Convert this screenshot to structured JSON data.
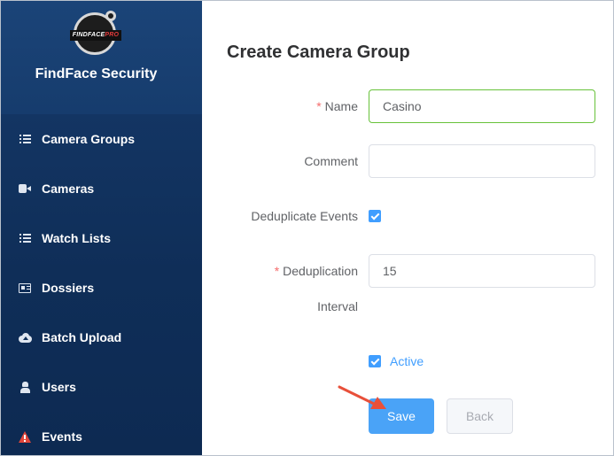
{
  "app": {
    "logo_text_main": "FINDFACE",
    "logo_text_pro": "PRO",
    "name": "FindFace Security"
  },
  "sidebar": {
    "items": [
      {
        "label": "Camera Groups",
        "icon": "list-icon"
      },
      {
        "label": "Cameras",
        "icon": "video-camera-icon"
      },
      {
        "label": "Watch Lists",
        "icon": "list-icon"
      },
      {
        "label": "Dossiers",
        "icon": "id-card-icon"
      },
      {
        "label": "Batch Upload",
        "icon": "cloud-upload-icon"
      },
      {
        "label": "Users",
        "icon": "user-secret-icon"
      },
      {
        "label": "Events",
        "icon": "warning-icon"
      }
    ]
  },
  "form": {
    "title": "Create Camera Group",
    "name_label": "Name",
    "name_value": "Casino",
    "comment_label": "Comment",
    "comment_value": "",
    "dedup_events_label": "Deduplicate Events",
    "dedup_events_checked": true,
    "dedup_interval_label_line1": "Deduplication",
    "dedup_interval_label_line2": "Interval",
    "dedup_interval_value": "15",
    "active_label": "Active",
    "active_checked": true,
    "save_label": "Save",
    "back_label": "Back"
  },
  "colors": {
    "sidebar_bg": "#0f2e58",
    "primary": "#409eff",
    "required": "#f56c6c",
    "focus_border": "#67c23a",
    "annotation_arrow": "#e8503a"
  }
}
